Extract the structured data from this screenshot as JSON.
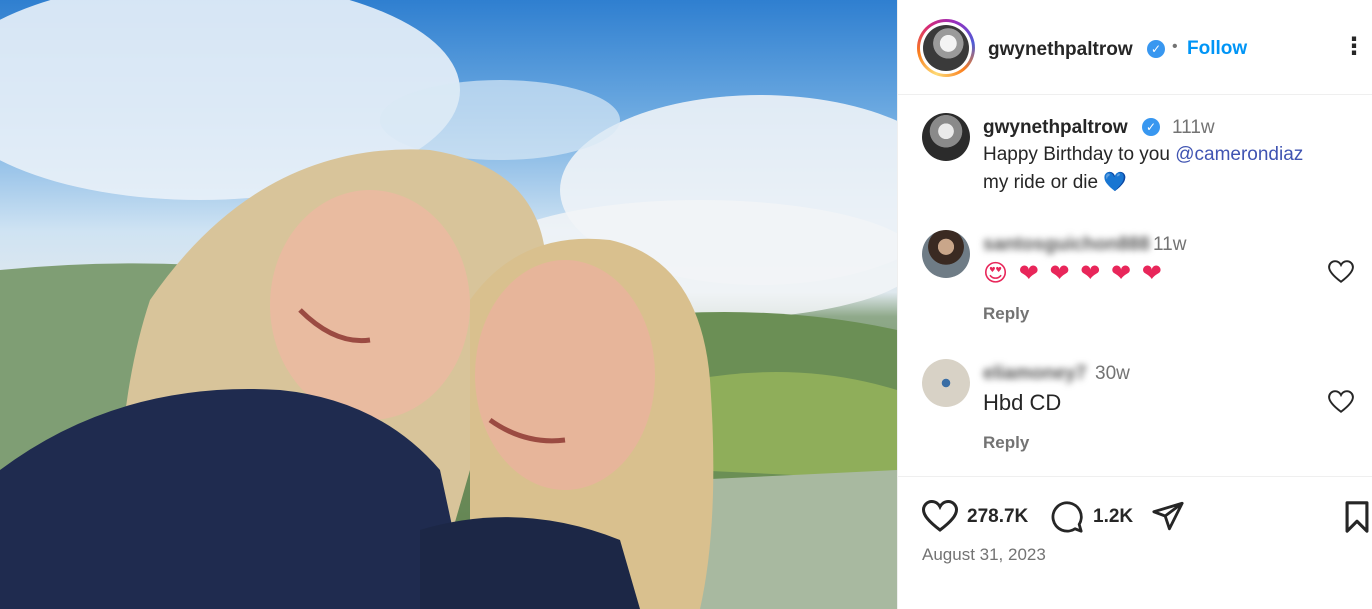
{
  "post": {
    "author": "gwynethpaltrow",
    "follow_label": "Follow",
    "separator": "•",
    "more_label": "⋮",
    "verified_mark": "✓"
  },
  "caption": {
    "username": "gwynethpaltrow",
    "time": "111w",
    "text_before": "Happy Birthday to you ",
    "mention": "@camerondiaz",
    "text_after": "my ride or die 💙"
  },
  "comments": [
    {
      "username": "santosguichon888",
      "time": "11w",
      "text": "😍 ❤ ❤ ❤ ❤ ❤",
      "reply_label": "Reply"
    },
    {
      "username": "eliamoney7",
      "time": "30w",
      "text": "Hbd CD",
      "reply_label": "Reply"
    }
  ],
  "actions": {
    "likes": "278.7K",
    "comments": "1.2K"
  },
  "date": "August 31, 2023",
  "colors": {
    "follow": "#0095f6",
    "mention": "#4054b2",
    "verified": "#3897f0",
    "heart_emoji": "#e8265a",
    "blue_heart": "#2f6fd8"
  }
}
